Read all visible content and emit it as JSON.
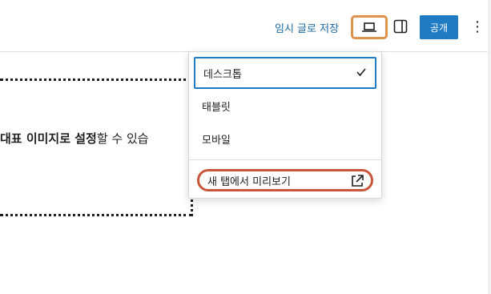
{
  "header": {
    "save_draft": "임시 글로 저장",
    "publish": "공개",
    "more": "⋮",
    "icons": {
      "preview": "laptop-icon",
      "settings": "sidebar-toggle-icon",
      "more": "more-vertical-icon"
    }
  },
  "content": {
    "body_bold": "대표 이미지로 설정",
    "body_rest": "할 수 있습"
  },
  "preview_menu": {
    "options": [
      "데스크톱",
      "태블릿",
      "모바일"
    ],
    "selected": "데스크톱",
    "open_new_tab": "새 탭에서 미리보기"
  },
  "colors": {
    "accent": "#1f7bc3",
    "highlight_orange": "#e0914a",
    "highlight_red": "#c8563a"
  }
}
